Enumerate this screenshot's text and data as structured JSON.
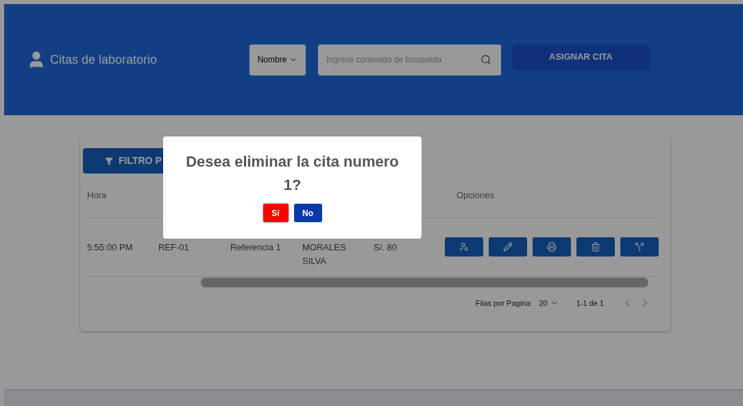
{
  "header": {
    "title": "Citas de laboratorio",
    "search_by": "Nombre",
    "search": {
      "placeholder": "Ingrese contenido de busqueda"
    },
    "action": "ASIGNAR CITA"
  },
  "filter_button": "FILTRO P",
  "table": {
    "columns": [
      "Hora",
      "",
      "",
      "",
      "",
      "Opciones"
    ],
    "rows": [
      {
        "cells": [
          "5:55:00 PM",
          "REF-01",
          "Referencia 1",
          "MORALES\nSILVA",
          "S/. 80"
        ],
        "actions": [
          {
            "kind": "view"
          },
          {
            "kind": "edit"
          },
          {
            "kind": "print"
          },
          {
            "kind": "delete"
          },
          {
            "kind": "forward"
          }
        ]
      }
    ]
  },
  "pagination": {
    "rows_label": "Filas por Pagina:",
    "rows_value": "20",
    "range": "1-1 de 1"
  },
  "dialog": {
    "message": "Desea eliminar la cita numero 1?",
    "confirm": "Sí",
    "cancel": "No"
  }
}
